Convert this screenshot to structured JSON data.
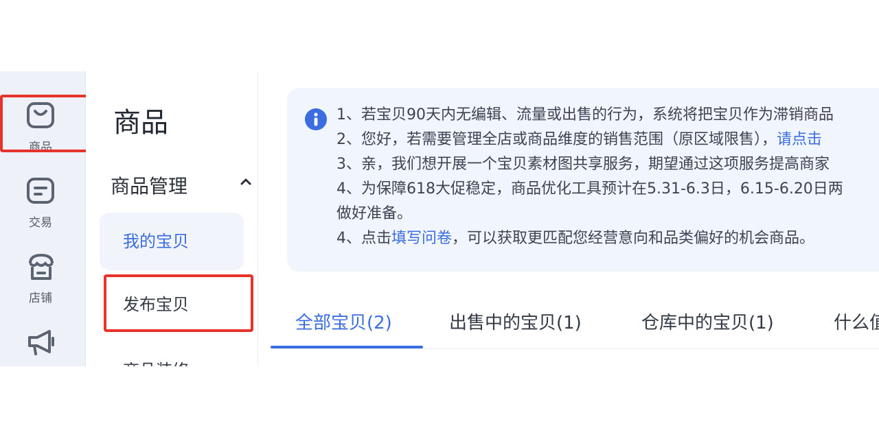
{
  "rail": {
    "items": [
      {
        "label": "商品",
        "icon": "bag-icon"
      },
      {
        "label": "交易",
        "icon": "document-icon"
      },
      {
        "label": "店铺",
        "icon": "store-icon"
      },
      {
        "label": "营销",
        "icon": "megaphone-icon"
      }
    ]
  },
  "subnav": {
    "title": "商品",
    "section": "商品管理",
    "items": [
      {
        "label": "我的宝贝"
      },
      {
        "label": "发布宝贝"
      },
      {
        "label": "商品装修"
      }
    ]
  },
  "notice": {
    "line1": "1、若宝贝90天内无编辑、流量或出售的行为，系统将把宝贝作为滞销商品",
    "line2_pre": "2、您好，若需要管理全店或商品维度的销售范围（原区域限售），",
    "line2_link": "请点击",
    "line3": "3、亲，我们想开展一个宝贝素材图共享服务，期望通过这项服务提高商家",
    "line4": "4、为保障618大促稳定，商品优化工具预计在5.31-6.3日，6.15-6.20日两",
    "line5": "做好准备。",
    "line6_pre": "4、点击",
    "line6_link": "填写问卷",
    "line6_post": "，可以获取更匹配您经营意向和品类偏好的机会商品。"
  },
  "tabs": [
    {
      "label": "全部宝贝(2)"
    },
    {
      "label": "出售中的宝贝(1)"
    },
    {
      "label": "仓库中的宝贝(1)"
    },
    {
      "label": "什么值"
    }
  ],
  "colors": {
    "accent": "#3b6de0",
    "highlight": "#e8332c",
    "rail_bg": "#eef1f8"
  }
}
